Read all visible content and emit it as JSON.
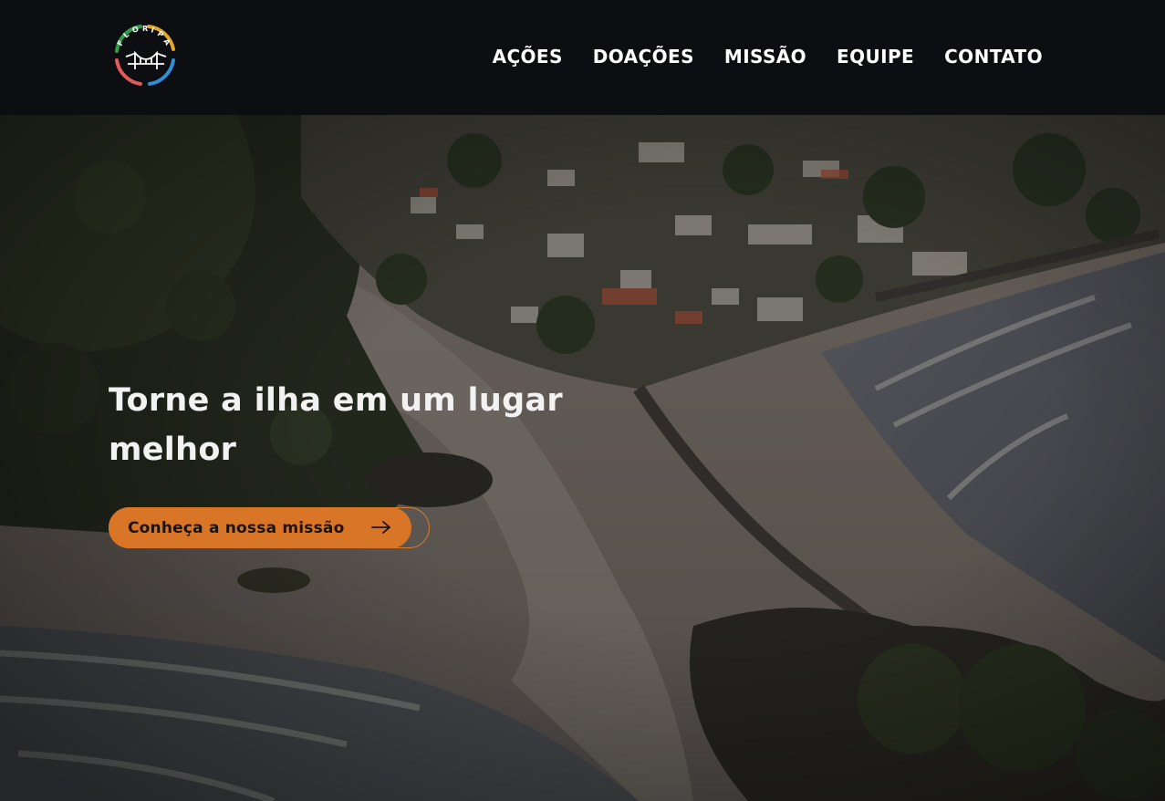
{
  "brand": {
    "logo_text": "FLORIPA",
    "logo_icon": "bridge-icon",
    "ring_colors": [
      "#2ea04a",
      "#e4a62b",
      "#2f8fd6",
      "#e05a5a"
    ]
  },
  "nav": {
    "items": [
      {
        "label": "AÇÕES"
      },
      {
        "label": "DOAÇÕES"
      },
      {
        "label": "MISSÃO"
      },
      {
        "label": "EQUIPE"
      },
      {
        "label": "CONTATO"
      }
    ]
  },
  "hero": {
    "title": "Torne a ilha em um lugar melhor",
    "cta": {
      "label": "Conheça a nossa missão",
      "icon": "arrow-right-icon",
      "color": "#d97527"
    }
  }
}
